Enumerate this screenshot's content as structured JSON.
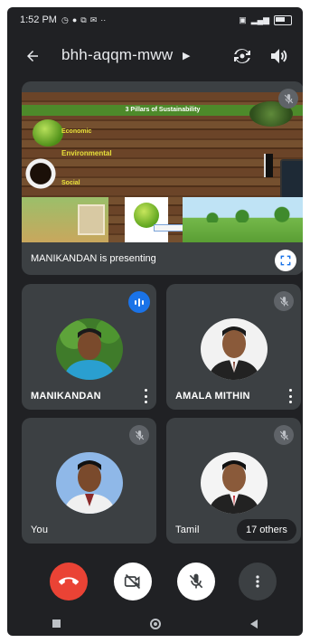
{
  "status_bar": {
    "time": "1:52 PM",
    "extra": "··"
  },
  "header": {
    "meeting_code": "bhh-aqqm-mww"
  },
  "presentation": {
    "slide_title": "3 Pillars of Sustainability",
    "pillars": [
      "Economic",
      "Environmental",
      "Social"
    ],
    "presenting_text": "MANIKANDAN is presenting"
  },
  "participants": [
    {
      "name": "MANIKANDAN",
      "state": "speaking"
    },
    {
      "name": "AMALA MITHIN",
      "state": "muted"
    },
    {
      "name": "You",
      "state": "muted"
    },
    {
      "name": "Tamil",
      "state": "muted"
    }
  ],
  "others_badge": "17 others",
  "colors": {
    "background": "#202124",
    "tile": "#3c4043",
    "end_call": "#ea4335",
    "speaking": "#1a73e8"
  },
  "icons": [
    "back-arrow-icon",
    "flip-camera-icon",
    "speaker-icon",
    "mic-off-icon",
    "fullscreen-icon",
    "call-end-icon",
    "video-off-icon",
    "more-vert-icon"
  ]
}
